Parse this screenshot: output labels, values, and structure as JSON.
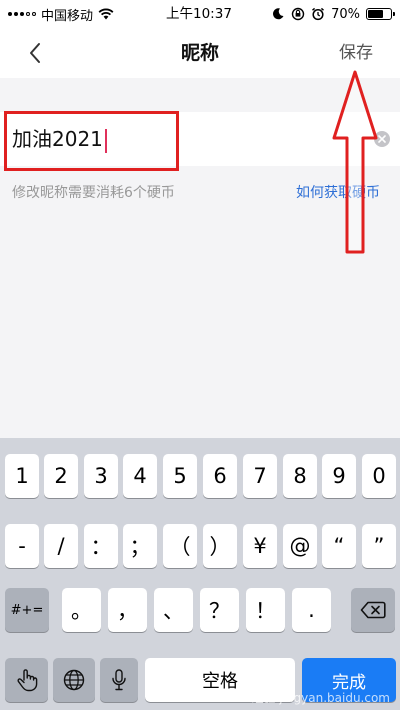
{
  "status_bar": {
    "carrier": "中国移动",
    "time": "上午10:37",
    "battery_percent": "70%",
    "battery_level": 0.7
  },
  "nav": {
    "title": "昵称",
    "save_label": "保存"
  },
  "form": {
    "nickname_value": "加油2021",
    "hint": "修改昵称需要消耗6个硬币",
    "help_link": "如何获取硬币"
  },
  "annotation_color": "#e02020",
  "keyboard": {
    "row1": [
      "1",
      "2",
      "3",
      "4",
      "5",
      "6",
      "7",
      "8",
      "9",
      "0"
    ],
    "row2": [
      "-",
      "/",
      "：",
      "；",
      "（",
      "）",
      "¥",
      "@",
      "“",
      "”"
    ],
    "row3_left": "#+=",
    "row3": [
      "。",
      "，",
      "、",
      "？",
      "！",
      "."
    ],
    "space_label": "空格",
    "confirm_label": "完成",
    "accent_color": "#1a7cf5"
  },
  "watermark": "Bai 经验 jingyan.baidu.com"
}
